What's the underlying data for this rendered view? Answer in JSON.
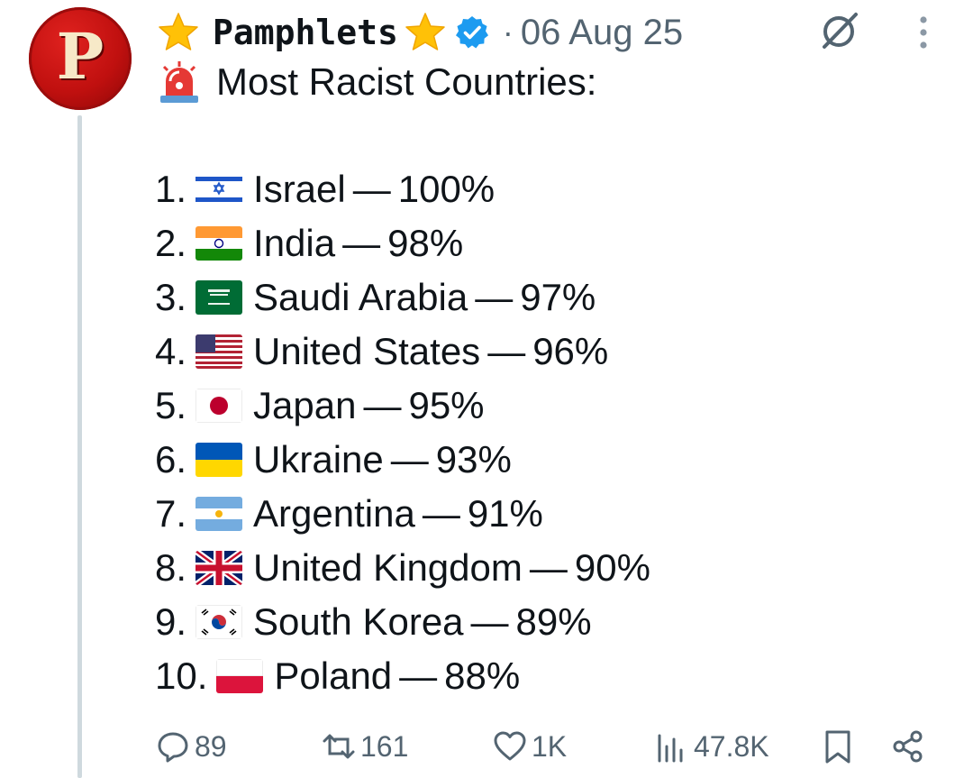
{
  "post": {
    "author": {
      "name": "Pamphlets",
      "avatar_letter": "P",
      "verified": true
    },
    "separator": "·",
    "date": "06 Aug 25",
    "title": "Most Racist Countries:",
    "list": [
      {
        "rank": "1.",
        "flag": "israel-flag-icon",
        "country": "Israel",
        "dash": "—",
        "value": "100%"
      },
      {
        "rank": "2.",
        "flag": "india-flag-icon",
        "country": "India",
        "dash": "—",
        "value": "98%"
      },
      {
        "rank": "3.",
        "flag": "saudi-arabia-flag-icon",
        "country": "Saudi Arabia",
        "dash": "—",
        "value": "97%"
      },
      {
        "rank": "4.",
        "flag": "united-states-flag-icon",
        "country": "United States",
        "dash": "—",
        "value": "96%"
      },
      {
        "rank": "5.",
        "flag": "japan-flag-icon",
        "country": "Japan",
        "dash": "—",
        "value": "95%"
      },
      {
        "rank": "6.",
        "flag": "ukraine-flag-icon",
        "country": "Ukraine",
        "dash": "—",
        "value": "93%"
      },
      {
        "rank": "7.",
        "flag": "argentina-flag-icon",
        "country": "Argentina",
        "dash": "—",
        "value": "91%"
      },
      {
        "rank": "8.",
        "flag": "united-kingdom-flag-icon",
        "country": "United Kingdom",
        "dash": "—",
        "value": "90%"
      },
      {
        "rank": "9.",
        "flag": "south-korea-flag-icon",
        "country": "South Korea",
        "dash": "—",
        "value": "89%"
      },
      {
        "rank": "10.",
        "flag": "poland-flag-icon",
        "country": "Poland",
        "dash": "—",
        "value": "88%"
      }
    ],
    "actions": {
      "replies": "89",
      "reposts": "161",
      "likes": "1K",
      "views": "47.8K"
    }
  },
  "colors": {
    "text": "#0f1419",
    "secondary": "#536471",
    "verified": "#1d9bf0",
    "avatar_red": "#c0100f",
    "thread_line": "#cfd9de"
  }
}
